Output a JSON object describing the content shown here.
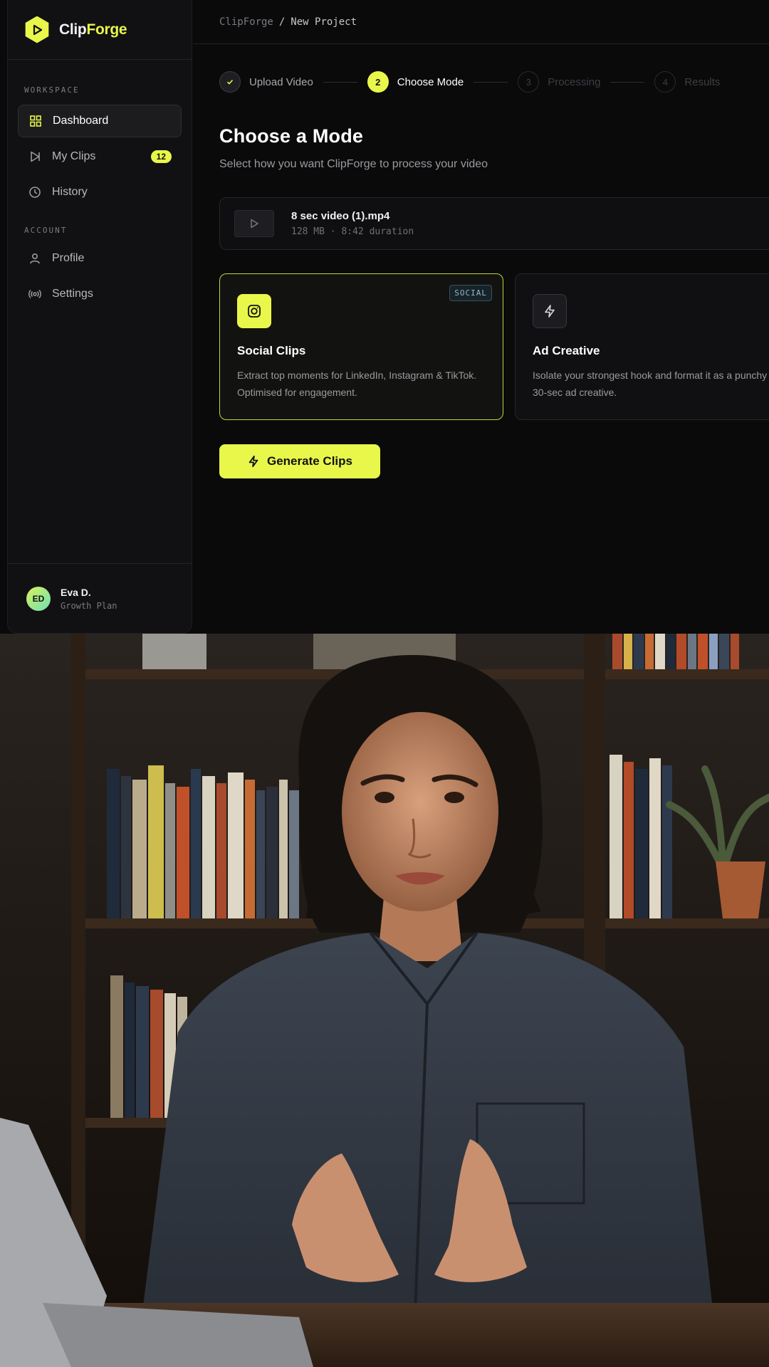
{
  "brand": {
    "name_part1": "Clip",
    "name_part2": "Forge"
  },
  "breadcrumb": {
    "root": "ClipForge",
    "sep": "/",
    "current": "New Project"
  },
  "sidebar": {
    "section_workspace": "WORKSPACE",
    "section_account": "ACCOUNT",
    "items": [
      {
        "label": "Dashboard",
        "icon": "grid-icon"
      },
      {
        "label": "My Clips",
        "icon": "play-outline-icon",
        "badge": "12"
      },
      {
        "label": "History",
        "icon": "clock-icon"
      },
      {
        "label": "Profile",
        "icon": "user-icon"
      },
      {
        "label": "Settings",
        "icon": "broadcast-icon"
      }
    ]
  },
  "user": {
    "initials": "ED",
    "name": "Eva D.",
    "plan": "Growth Plan"
  },
  "stepper": {
    "steps": [
      {
        "num": "✓",
        "label": "Upload Video",
        "state": "done"
      },
      {
        "num": "2",
        "label": "Choose Mode",
        "state": "current"
      },
      {
        "num": "3",
        "label": "Processing",
        "state": "todo"
      },
      {
        "num": "4",
        "label": "Results",
        "state": "todo"
      }
    ]
  },
  "main": {
    "title": "Choose a Mode",
    "subtitle": "Select how you want ClipForge to process your video"
  },
  "file": {
    "name": "8 sec video (1).mp4",
    "meta": "128 MB · 8:42 duration"
  },
  "modes": [
    {
      "title": "Social Clips",
      "desc": "Extract top moments for LinkedIn, Instagram & TikTok. Optimised for engagement.",
      "tag": "SOCIAL",
      "icon": "instagram-icon",
      "selected": true
    },
    {
      "title": "Ad Creative",
      "desc": "Isolate your strongest hook and format it as a punchy 30-sec ad creative.",
      "icon": "lightning-icon",
      "selected": false
    }
  ],
  "generate_label": "Generate Clips",
  "colors": {
    "accent": "#e8f74a",
    "background": "#0a0a0b",
    "panel": "#111113"
  }
}
